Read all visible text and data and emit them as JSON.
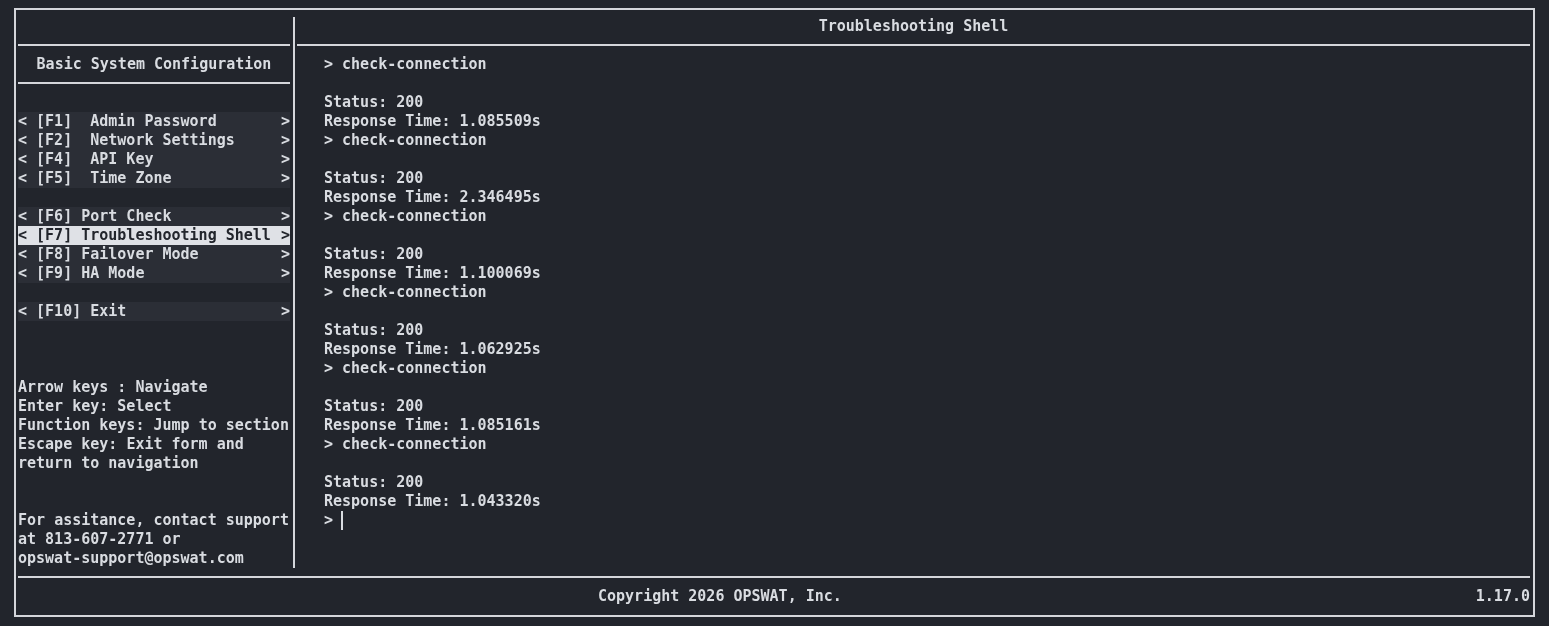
{
  "sidebar": {
    "title": "Basic System Configuration",
    "menu_groups": [
      {
        "items": [
          {
            "text": "< [F1]  Admin Password",
            "end": ">",
            "selected": false
          },
          {
            "text": "< [F2]  Network Settings",
            "end": ">",
            "selected": false
          },
          {
            "text": "< [F4]  API Key",
            "end": ">",
            "selected": false
          },
          {
            "text": "< [F5]  Time Zone",
            "end": ">",
            "selected": false
          }
        ]
      },
      {
        "items": [
          {
            "text": "< [F6] Port Check",
            "end": ">",
            "selected": false
          },
          {
            "text": "< [F7] Troubleshooting Shell",
            "end": ">",
            "selected": true
          },
          {
            "text": "< [F8] Failover Mode",
            "end": ">",
            "selected": false
          },
          {
            "text": "< [F9] HA Mode",
            "end": ">",
            "selected": false
          }
        ]
      },
      {
        "items": [
          {
            "text": "< [F10] Exit",
            "end": ">",
            "selected": false
          }
        ]
      }
    ],
    "help": [
      "Arrow keys : Navigate",
      "Enter key: Select",
      "Function keys: Jump to section",
      "Escape key: Exit form and return to navigation"
    ],
    "contact": "For assitance, contact support at 813-607-2771 or opswat-support@opswat.com"
  },
  "shell": {
    "title": "Troubleshooting Shell",
    "entries": [
      {
        "command": "> check-connection",
        "output": [
          "Status: 200",
          "Response Time: 1.085509s"
        ]
      },
      {
        "command": "> check-connection",
        "output": [
          "Status: 200",
          "Response Time: 2.346495s"
        ]
      },
      {
        "command": "> check-connection",
        "output": [
          "Status: 200",
          "Response Time: 1.100069s"
        ]
      },
      {
        "command": "> check-connection",
        "output": [
          "Status: 200",
          "Response Time: 1.062925s"
        ]
      },
      {
        "command": "> check-connection",
        "output": [
          "Status: 200",
          "Response Time: 1.085161s"
        ]
      },
      {
        "command": "> check-connection",
        "output": [
          "Status: 200",
          "Response Time: 1.043320s"
        ]
      }
    ],
    "prompt": ">"
  },
  "footer": {
    "copyright": "Copyright 2026 OPSWAT, Inc.",
    "version": "1.17.0"
  }
}
